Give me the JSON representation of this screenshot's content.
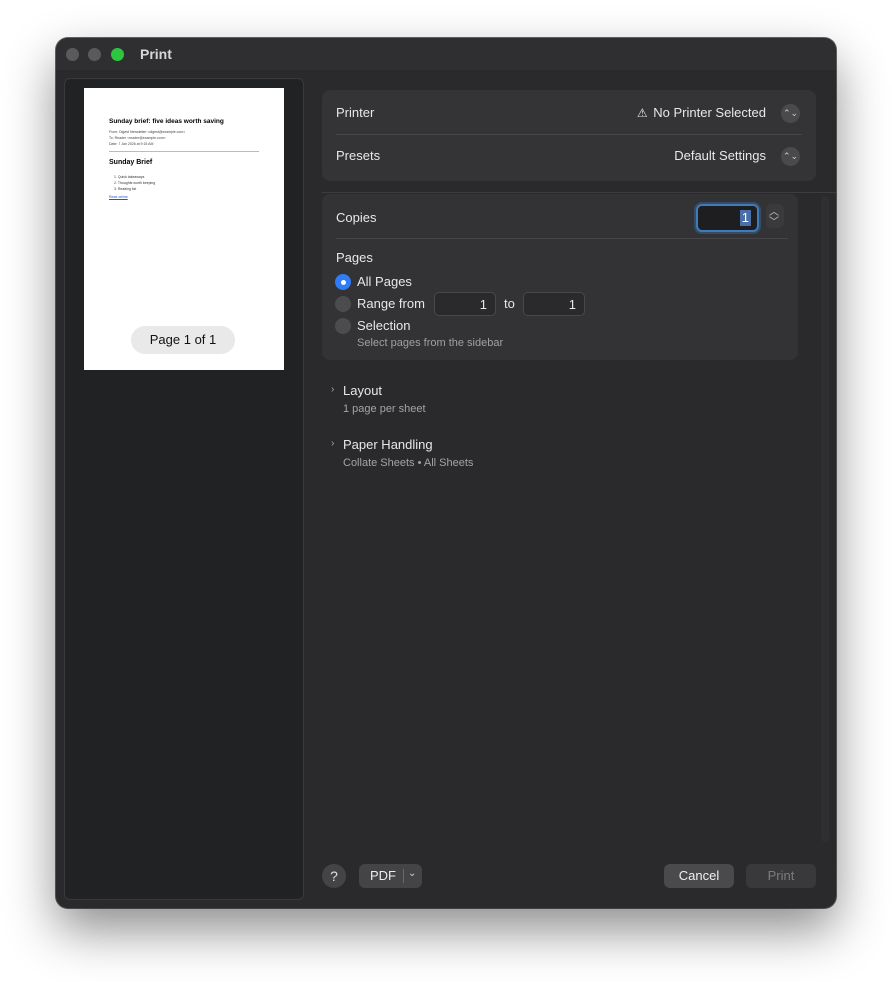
{
  "window": {
    "title": "Print"
  },
  "preview": {
    "doc_title": "Sunday brief: five ideas worth saving",
    "meta_lines": [
      "From: Digest Newsletter <digest@example.com>",
      "To: Reader <reader@example.com>",
      "Date: 7 Jan 2026 at 9:15 AM"
    ],
    "heading": "Sunday Brief",
    "list_items": [
      "1. Quick takeaways",
      "2. Thoughts worth keeping",
      "3. Reading list"
    ],
    "link_text": "Read online",
    "page_label": "Page 1 of 1"
  },
  "printer": {
    "label": "Printer",
    "value": "No Printer Selected"
  },
  "presets": {
    "label": "Presets",
    "value": "Default Settings"
  },
  "copies": {
    "label": "Copies",
    "value": "1"
  },
  "pages": {
    "label": "Pages",
    "all_pages": "All Pages",
    "range_from": "Range from",
    "range_start": "1",
    "range_to": "to",
    "range_end": "1",
    "selection": "Selection",
    "selection_hint": "Select pages from the sidebar",
    "selected": "all"
  },
  "layout": {
    "title": "Layout",
    "subtitle": "1 page per sheet"
  },
  "paper_handling": {
    "title": "Paper Handling",
    "subtitle": "Collate Sheets • All Sheets"
  },
  "footer": {
    "help": "?",
    "pdf": "PDF",
    "cancel": "Cancel",
    "print": "Print"
  },
  "icons": {
    "warning": "⚠",
    "updown": "⌃⌄",
    "chevron_right": "›",
    "chevron_down": "⌄"
  },
  "colors": {
    "accent": "#2f7cf6",
    "traffic_green": "#2dc640",
    "focus_ring": "#3e7bbd"
  }
}
